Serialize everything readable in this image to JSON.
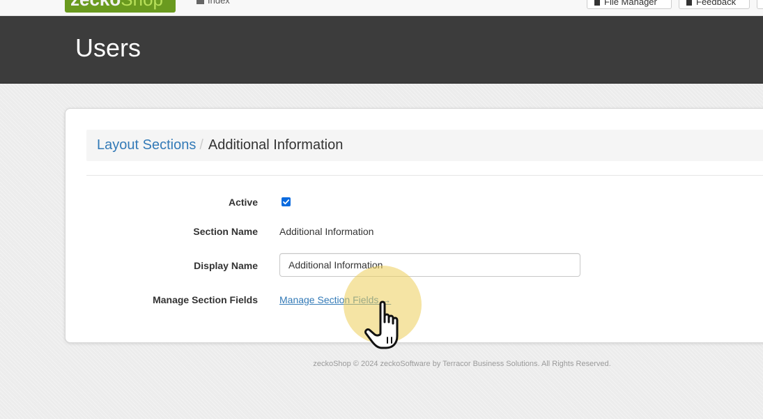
{
  "app": {
    "logo_part1": "zecko",
    "logo_part2": "Shop",
    "nav_index": "Index",
    "file_manager_label": "File Manager",
    "feedback_label": "Feedback"
  },
  "header": {
    "title": "Users"
  },
  "breadcrumb": {
    "parent": "Layout Sections",
    "separator": "/",
    "current": "Additional Information"
  },
  "form": {
    "active": {
      "label": "Active",
      "checked": true
    },
    "section_name": {
      "label": "Section Name",
      "value": "Additional Information"
    },
    "display_name": {
      "label": "Display Name",
      "value": "Additional Information"
    },
    "manage_fields": {
      "label": "Manage Section Fields",
      "link_text": "Manage Section Fields →"
    }
  },
  "footer": {
    "text": "zeckoShop © 2024 zeckoSoftware by Terracor Business Solutions. All Rights Reserved."
  },
  "colors": {
    "header_bg": "#3c3c3c",
    "link": "#337ab7",
    "checkbox": "#0b6bdf",
    "logo_green": "#6a9a1f",
    "click_highlight": "#edcd5a"
  }
}
